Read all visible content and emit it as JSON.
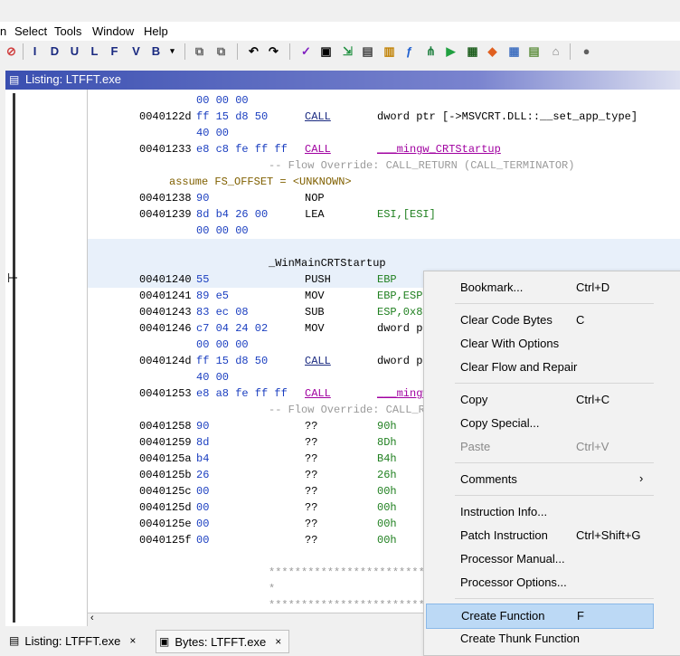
{
  "menu": [
    "n",
    "Select",
    "Tools",
    "Window",
    "Help"
  ],
  "toolbar_letters": [
    "I",
    "D",
    "U",
    "L",
    "F",
    "V",
    "B"
  ],
  "window_title": "Listing:  LTFFT.exe",
  "listing": [
    {
      "addr": "",
      "bytes": "00 00 00",
      "mn": "",
      "ops": ""
    },
    {
      "addr": "0040122d",
      "bytes": "ff 15 d8 50",
      "mn": "CALL",
      "ops": "dword ptr [->MSVCRT.DLL::__set_app_type]",
      "call": true
    },
    {
      "addr": "",
      "bytes": "40 00",
      "mn": "",
      "ops": ""
    },
    {
      "addr": "00401233",
      "bytes": "e8 c8 fe ff ff",
      "mn": "CALL",
      "ops": "___mingw_CRTStartup",
      "call": true,
      "magenta": true
    },
    {
      "comment": "-- Flow Override: CALL_RETURN (CALL_TERMINATOR)"
    },
    {
      "assume": "assume FS_OFFSET = <UNKNOWN>"
    },
    {
      "addr": "00401238",
      "bytes": "90",
      "mn": "NOP",
      "ops": ""
    },
    {
      "addr": "00401239",
      "bytes": "8d b4 26 00",
      "mn": "LEA",
      "ops": "ESI,[ESI]"
    },
    {
      "addr": "",
      "bytes": "00 00 00",
      "mn": "",
      "ops": ""
    },
    {
      "blank": true
    },
    {
      "label": "_WinMainCRTStartup"
    },
    {
      "addr": "00401240",
      "bytes": "55",
      "mn": "PUSH",
      "ops": "EBP"
    },
    {
      "addr": "00401241",
      "bytes": "89 e5",
      "mn": "MOV",
      "ops": "EBP,ESP"
    },
    {
      "addr": "00401243",
      "bytes": "83 ec 08",
      "mn": "SUB",
      "ops": "ESP,0x8"
    },
    {
      "addr": "00401246",
      "bytes": "c7 04 24 02",
      "mn": "MOV",
      "ops": "dword pt"
    },
    {
      "addr": "",
      "bytes": "00 00 00",
      "mn": "",
      "ops": ""
    },
    {
      "addr": "0040124d",
      "bytes": "ff 15 d8 50",
      "mn": "CALL",
      "ops": "dword pt",
      "call": true
    },
    {
      "addr": "",
      "bytes": "40 00",
      "mn": "",
      "ops": ""
    },
    {
      "addr": "00401253",
      "bytes": "e8 a8 fe ff ff",
      "mn": "CALL",
      "ops": "___mingw",
      "call": true,
      "magenta": true
    },
    {
      "comment": "-- Flow Override: CALL_RE"
    },
    {
      "addr": "00401258",
      "bytes": "90",
      "mn": "??",
      "ops": "90h"
    },
    {
      "addr": "00401259",
      "bytes": "8d",
      "mn": "??",
      "ops": "8Dh"
    },
    {
      "addr": "0040125a",
      "bytes": "b4",
      "mn": "??",
      "ops": "B4h"
    },
    {
      "addr": "0040125b",
      "bytes": "26",
      "mn": "??",
      "ops": "26h"
    },
    {
      "addr": "0040125c",
      "bytes": "00",
      "mn": "??",
      "ops": "00h"
    },
    {
      "addr": "0040125d",
      "bytes": "00",
      "mn": "??",
      "ops": "00h"
    },
    {
      "addr": "0040125e",
      "bytes": "00",
      "mn": "??",
      "ops": "00h"
    },
    {
      "addr": "0040125f",
      "bytes": "00",
      "mn": "??",
      "ops": "00h"
    },
    {
      "blank": true
    },
    {
      "stars": "**************************"
    },
    {
      "stars": "*"
    },
    {
      "stars": "**************************"
    }
  ],
  "context_menu": [
    {
      "label": "Bookmark...",
      "shortcut": "Ctrl+D"
    },
    {
      "sep": true
    },
    {
      "label": "Clear Code Bytes",
      "shortcut": "C"
    },
    {
      "label": "Clear With Options",
      "shortcut": ""
    },
    {
      "label": "Clear Flow and Repair",
      "shortcut": ""
    },
    {
      "sep": true
    },
    {
      "label": "Copy",
      "shortcut": "Ctrl+C"
    },
    {
      "label": "Copy Special...",
      "shortcut": ""
    },
    {
      "label": "Paste",
      "shortcut": "Ctrl+V",
      "disabled": true
    },
    {
      "sep": true
    },
    {
      "label": "Comments",
      "shortcut": "",
      "submenu": true
    },
    {
      "sep": true
    },
    {
      "label": "Instruction Info...",
      "shortcut": ""
    },
    {
      "label": "Patch Instruction",
      "shortcut": "Ctrl+Shift+G"
    },
    {
      "label": "Processor Manual...",
      "shortcut": ""
    },
    {
      "label": "Processor Options...",
      "shortcut": ""
    },
    {
      "sep": true
    },
    {
      "label": "Create Function",
      "shortcut": "F",
      "highlight": true
    },
    {
      "label": "Create Thunk Function",
      "shortcut": ""
    }
  ],
  "tabs": [
    {
      "label": "Listing:  LTFFT.exe",
      "close": "×"
    },
    {
      "label": "Bytes: LTFFT.exe",
      "close": "×"
    }
  ],
  "colors": {
    "title_gradient": "#3a4fb0",
    "bytes": "#1a3ec0",
    "call": "#a000a0",
    "highlight": "#bcd9f5",
    "selected_row": "#e8f0fa"
  }
}
